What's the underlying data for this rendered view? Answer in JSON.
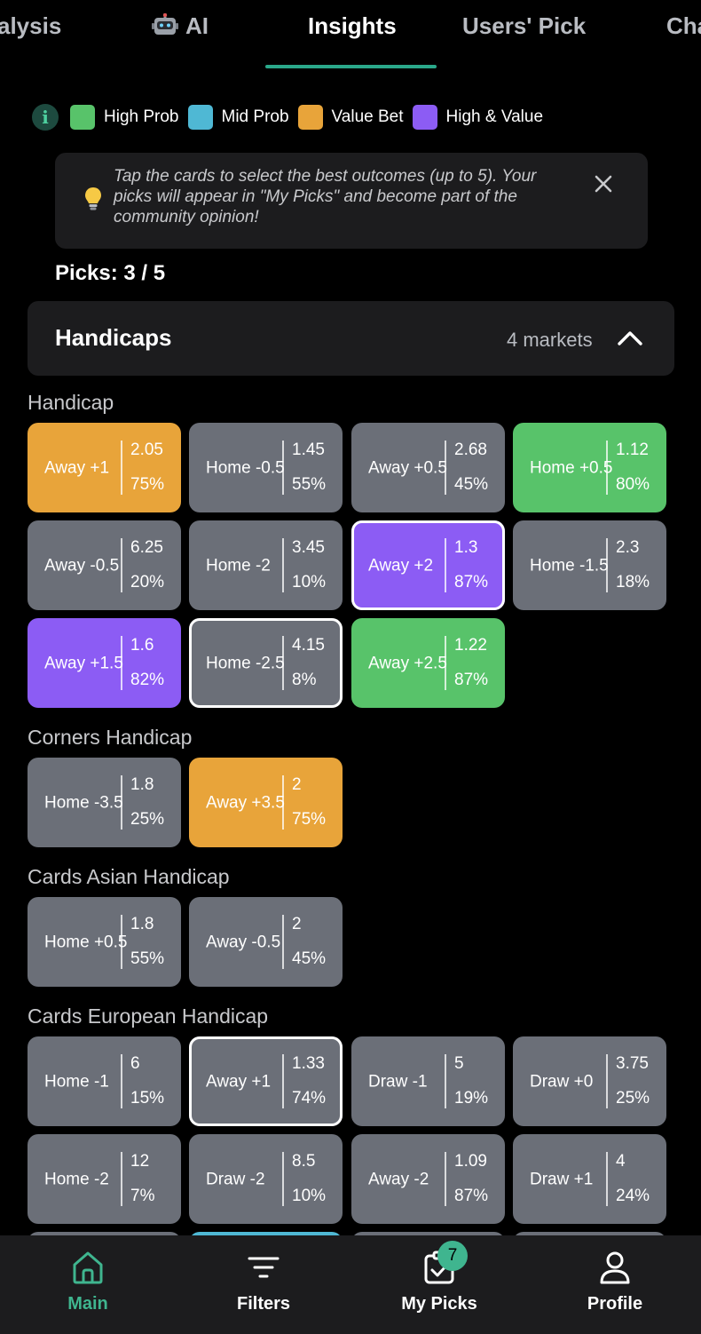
{
  "tabs": [
    {
      "label": "alysis"
    },
    {
      "label": "AI",
      "icon": "robot-icon"
    },
    {
      "label": "Insights",
      "active": true
    },
    {
      "label": "Users' Pick"
    },
    {
      "label": "Cha"
    }
  ],
  "legend": {
    "info_icon": "info-icon",
    "items": [
      {
        "label": "High Prob",
        "color": "#58c36a"
      },
      {
        "label": "Mid Prob",
        "color": "#4fb8d4"
      },
      {
        "label": "Value Bet",
        "color": "#e8a43a"
      },
      {
        "label": "High & Value",
        "color": "#8c5cf4"
      }
    ]
  },
  "tip": {
    "text": "Tap the cards to select the best outcomes (up to 5). Your picks will appear in \"My Picks\" and become part of the community opinion!",
    "icon": "lightbulb-icon",
    "close_icon": "close-icon"
  },
  "picks": "Picks: 3 / 5",
  "accordion": {
    "title": "Handicaps",
    "count": "4 markets",
    "icon": "chevron-up-icon"
  },
  "markets": [
    {
      "title": "Handicap",
      "cards": [
        {
          "label": "Away +1",
          "odds": "2.05",
          "prob": "75%",
          "type": "value",
          "selected": false
        },
        {
          "label": "Home -0.5",
          "odds": "1.45",
          "prob": "55%",
          "type": "default",
          "selected": false
        },
        {
          "label": "Away +0.5",
          "odds": "2.68",
          "prob": "45%",
          "type": "default",
          "selected": false
        },
        {
          "label": "Home +0.5",
          "odds": "1.12",
          "prob": "80%",
          "type": "high",
          "selected": false
        },
        {
          "label": "Away -0.5",
          "odds": "6.25",
          "prob": "20%",
          "type": "default",
          "selected": false
        },
        {
          "label": "Home -2",
          "odds": "3.45",
          "prob": "10%",
          "type": "default",
          "selected": false
        },
        {
          "label": "Away +2",
          "odds": "1.3",
          "prob": "87%",
          "type": "hv",
          "selected": true
        },
        {
          "label": "Home -1.5",
          "odds": "2.3",
          "prob": "18%",
          "type": "default",
          "selected": false
        },
        {
          "label": "Away +1.5",
          "odds": "1.6",
          "prob": "82%",
          "type": "hv",
          "selected": false
        },
        {
          "label": "Home -2.5",
          "odds": "4.15",
          "prob": "8%",
          "type": "default",
          "selected": true
        },
        {
          "label": "Away +2.5",
          "odds": "1.22",
          "prob": "87%",
          "type": "high",
          "selected": false
        }
      ]
    },
    {
      "title": "Corners Handicap",
      "cards": [
        {
          "label": "Home -3.5",
          "odds": "1.8",
          "prob": "25%",
          "type": "default",
          "selected": false
        },
        {
          "label": "Away +3.5",
          "odds": "2",
          "prob": "75%",
          "type": "value",
          "selected": false
        }
      ]
    },
    {
      "title": "Cards Asian Handicap",
      "cards": [
        {
          "label": "Home +0.5",
          "odds": "1.8",
          "prob": "55%",
          "type": "default",
          "selected": false
        },
        {
          "label": "Away -0.5",
          "odds": "2",
          "prob": "45%",
          "type": "default",
          "selected": false
        }
      ]
    },
    {
      "title": "Cards European Handicap",
      "cards": [
        {
          "label": "Home -1",
          "odds": "6",
          "prob": "15%",
          "type": "default",
          "selected": false
        },
        {
          "label": "Away +1",
          "odds": "1.33",
          "prob": "74%",
          "type": "default",
          "selected": true
        },
        {
          "label": "Draw -1",
          "odds": "5",
          "prob": "19%",
          "type": "default",
          "selected": false
        },
        {
          "label": "Draw +0",
          "odds": "3.75",
          "prob": "25%",
          "type": "default",
          "selected": false
        },
        {
          "label": "Home -2",
          "odds": "12",
          "prob": "7%",
          "type": "default",
          "selected": false
        },
        {
          "label": "Draw -2",
          "odds": "8.5",
          "prob": "10%",
          "type": "default",
          "selected": false
        },
        {
          "label": "Away -2",
          "odds": "1.09",
          "prob": "87%",
          "type": "default",
          "selected": false
        },
        {
          "label": "Draw +1",
          "odds": "4",
          "prob": "24%",
          "type": "default",
          "selected": false
        }
      ]
    }
  ],
  "bottom_nav": [
    {
      "label": "Main",
      "icon": "home-icon",
      "active": true
    },
    {
      "label": "Filters",
      "icon": "filter-icon",
      "active": false
    },
    {
      "label": "My Picks",
      "icon": "my-picks-icon",
      "active": false,
      "badge": "7"
    },
    {
      "label": "Profile",
      "icon": "profile-icon",
      "active": false
    }
  ]
}
